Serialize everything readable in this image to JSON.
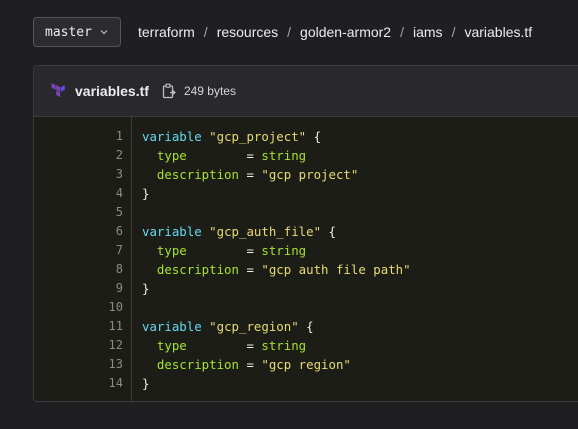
{
  "branch": {
    "label": "master"
  },
  "breadcrumb": [
    "terraform",
    "resources",
    "golden-armor2",
    "iams",
    "variables.tf"
  ],
  "breadcrumb_separator": "/",
  "file": {
    "name": "variables.tf",
    "size": "249 bytes"
  },
  "code_lines": [
    {
      "n": "1",
      "parts": [
        {
          "t": "variable",
          "c": "kw"
        },
        {
          "t": " ",
          "c": "op"
        },
        {
          "t": "\"gcp_project\"",
          "c": "str"
        },
        {
          "t": " {",
          "c": "op"
        }
      ]
    },
    {
      "n": "2",
      "parts": [
        {
          "t": "  ",
          "c": "op"
        },
        {
          "t": "type",
          "c": "attr"
        },
        {
          "t": "        = ",
          "c": "op"
        },
        {
          "t": "string",
          "c": "attr"
        }
      ]
    },
    {
      "n": "3",
      "parts": [
        {
          "t": "  ",
          "c": "op"
        },
        {
          "t": "description",
          "c": "attr"
        },
        {
          "t": " = ",
          "c": "op"
        },
        {
          "t": "\"gcp project\"",
          "c": "str"
        }
      ]
    },
    {
      "n": "4",
      "parts": [
        {
          "t": "}",
          "c": "op"
        }
      ]
    },
    {
      "n": "5",
      "parts": []
    },
    {
      "n": "6",
      "parts": [
        {
          "t": "variable",
          "c": "kw"
        },
        {
          "t": " ",
          "c": "op"
        },
        {
          "t": "\"gcp_auth_file\"",
          "c": "str"
        },
        {
          "t": " {",
          "c": "op"
        }
      ]
    },
    {
      "n": "7",
      "parts": [
        {
          "t": "  ",
          "c": "op"
        },
        {
          "t": "type",
          "c": "attr"
        },
        {
          "t": "        = ",
          "c": "op"
        },
        {
          "t": "string",
          "c": "attr"
        }
      ]
    },
    {
      "n": "8",
      "parts": [
        {
          "t": "  ",
          "c": "op"
        },
        {
          "t": "description",
          "c": "attr"
        },
        {
          "t": " = ",
          "c": "op"
        },
        {
          "t": "\"gcp auth file path\"",
          "c": "str"
        }
      ]
    },
    {
      "n": "9",
      "parts": [
        {
          "t": "}",
          "c": "op"
        }
      ]
    },
    {
      "n": "10",
      "parts": []
    },
    {
      "n": "11",
      "parts": [
        {
          "t": "variable",
          "c": "kw"
        },
        {
          "t": " ",
          "c": "op"
        },
        {
          "t": "\"gcp_region\"",
          "c": "str"
        },
        {
          "t": " {",
          "c": "op"
        }
      ]
    },
    {
      "n": "12",
      "parts": [
        {
          "t": "  ",
          "c": "op"
        },
        {
          "t": "type",
          "c": "attr"
        },
        {
          "t": "        = ",
          "c": "op"
        },
        {
          "t": "string",
          "c": "attr"
        }
      ]
    },
    {
      "n": "13",
      "parts": [
        {
          "t": "  ",
          "c": "op"
        },
        {
          "t": "description",
          "c": "attr"
        },
        {
          "t": " = ",
          "c": "op"
        },
        {
          "t": "\"gcp region\"",
          "c": "str"
        }
      ]
    },
    {
      "n": "14",
      "parts": [
        {
          "t": "}",
          "c": "op"
        }
      ]
    }
  ],
  "icons": [
    "chevron-down-icon",
    "terraform-icon",
    "copy-icon"
  ],
  "colors": {
    "keyword": "#66d9ef",
    "string": "#e6db74",
    "attribute": "#a6e22e",
    "terraform_brand": "#7b42bc"
  }
}
